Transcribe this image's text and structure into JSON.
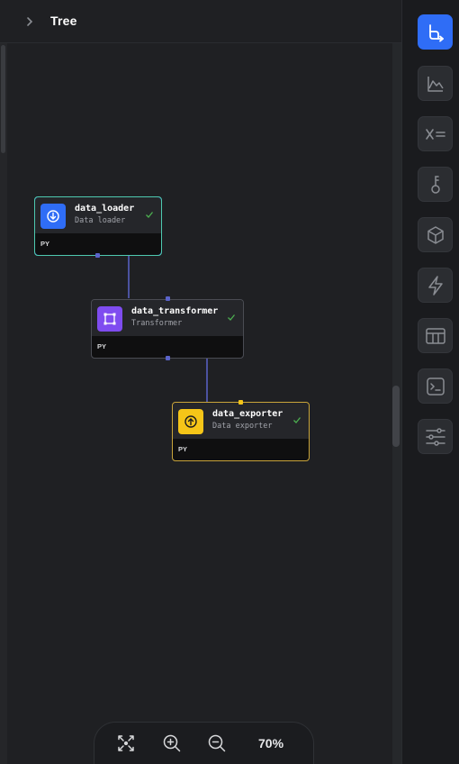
{
  "header": {
    "title": "Tree"
  },
  "nodes": [
    {
      "name": "data_loader",
      "subtitle": "Data loader",
      "lang": "PY",
      "color": "#2f6df6",
      "border": "#4ec9b0"
    },
    {
      "name": "data_transformer",
      "subtitle": "Transformer",
      "lang": "PY",
      "color": "#7f4cf0",
      "border": "#4a4c53"
    },
    {
      "name": "data_exporter",
      "subtitle": "Data exporter",
      "lang": "PY",
      "color": "#f5c518",
      "border": "#c9a43a"
    }
  ],
  "zoom": {
    "level": "70%"
  },
  "rail": {
    "items": [
      "tree-icon",
      "chart-icon",
      "variables-icon",
      "secrets-icon",
      "blocks-icon",
      "trigger-icon",
      "table-icon",
      "terminal-icon",
      "settings-icon"
    ]
  }
}
